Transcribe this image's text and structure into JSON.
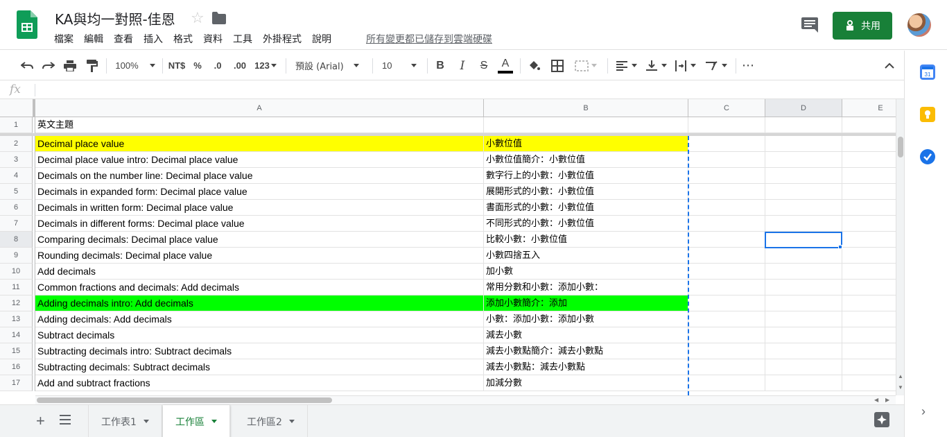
{
  "header": {
    "doc_title": "KA與均一對照-佳恩",
    "menu": [
      "檔案",
      "編輯",
      "查看",
      "插入",
      "格式",
      "資料",
      "工具",
      "外掛程式",
      "說明"
    ],
    "save_status": "所有變更都已儲存到雲端硬碟",
    "share_label": "共用"
  },
  "toolbar": {
    "zoom": "100%",
    "currency": "NT$",
    "percent": "%",
    "dec_decrease": ".0",
    "dec_increase": ".00",
    "more_formats": "123",
    "font": "預設 (Arial)",
    "font_size": "10",
    "bold": "B",
    "italic": "I",
    "strike": "S",
    "text_color": "A",
    "more": "⋯"
  },
  "formula_bar": {
    "fx": "fx"
  },
  "columns": [
    {
      "label": "A"
    },
    {
      "label": "B"
    },
    {
      "label": "C"
    },
    {
      "label": "D"
    },
    {
      "label": "E"
    }
  ],
  "rows": [
    {
      "num": "1",
      "a": "英文主題",
      "b": "",
      "highlight": ""
    },
    {
      "num": "2",
      "a": "Decimal place value",
      "b": "小數位值",
      "highlight": "#ffff00"
    },
    {
      "num": "3",
      "a": "Decimal place value intro: Decimal place value",
      "b": "小數位值簡介：小數位值",
      "highlight": ""
    },
    {
      "num": "4",
      "a": "Decimals on the number line: Decimal place value",
      "b": "數字行上的小數：小數位值",
      "highlight": ""
    },
    {
      "num": "5",
      "a": "Decimals in expanded form: Decimal place value",
      "b": "展開形式的小數：小數位值",
      "highlight": ""
    },
    {
      "num": "6",
      "a": "Decimals in written form: Decimal place value",
      "b": "書面形式的小數：小數位值",
      "highlight": ""
    },
    {
      "num": "7",
      "a": "Decimals in different forms: Decimal place value",
      "b": "不同形式的小數：小數位值",
      "highlight": ""
    },
    {
      "num": "8",
      "a": "Comparing decimals: Decimal place value",
      "b": "比較小數：小數位值",
      "highlight": ""
    },
    {
      "num": "9",
      "a": "Rounding decimals: Decimal place value",
      "b": "小數四捨五入",
      "highlight": ""
    },
    {
      "num": "10",
      "a": "Add decimals",
      "b": "加小數",
      "highlight": ""
    },
    {
      "num": "11",
      "a": "Common fractions and decimals: Add decimals",
      "b": "常用分數和小數：添加小數：",
      "highlight": ""
    },
    {
      "num": "12",
      "a": "Adding decimals intro: Add decimals",
      "b": "添加小數簡介：添加",
      "highlight": "#00ff00"
    },
    {
      "num": "13",
      "a": "Adding decimals: Add decimals",
      "b": "小數：添加小數：添加小數",
      "highlight": ""
    },
    {
      "num": "14",
      "a": "Subtract decimals",
      "b": "減去小數",
      "highlight": ""
    },
    {
      "num": "15",
      "a": "Subtracting decimals intro: Subtract decimals",
      "b": "減去小數點簡介：減去小數點",
      "highlight": ""
    },
    {
      "num": "16",
      "a": "Subtracting decimals: Subtract decimals",
      "b": "減去小數點：減去小數點",
      "highlight": ""
    },
    {
      "num": "17",
      "a": "Add and subtract fractions",
      "b": "加減分數",
      "highlight": ""
    }
  ],
  "sheets": [
    {
      "label": "工作表1",
      "active": false
    },
    {
      "label": "工作區",
      "active": true
    },
    {
      "label": "工作區2",
      "active": false
    }
  ],
  "colors": {
    "accent": "#1a73e8",
    "share_green": "#188038",
    "row_yellow": "#ffff00",
    "row_green": "#00ff00"
  },
  "icons": {
    "calendar": "calendar-icon",
    "keep": "keep-icon",
    "tasks": "tasks-icon",
    "explore": "explore-icon"
  }
}
